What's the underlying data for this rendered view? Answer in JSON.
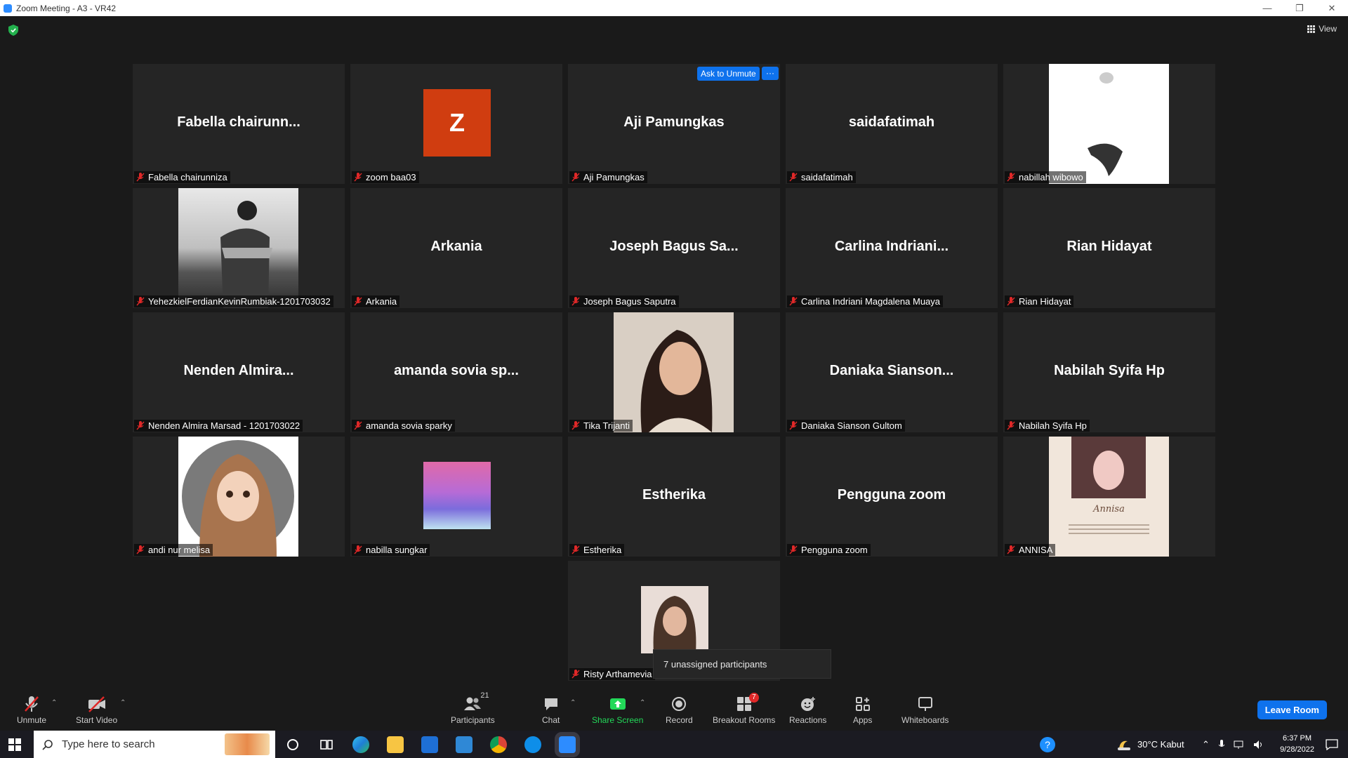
{
  "window": {
    "title": "Zoom Meeting - A3 - VR42"
  },
  "header": {
    "view_label": "View",
    "ask_to_unmute": "Ask to Unmute",
    "more": "···"
  },
  "tiles": [
    {
      "display": "Fabella  chairunn...",
      "label": "Fabella chairunniza"
    },
    {
      "display": "Z",
      "label": "zoom baa03"
    },
    {
      "display": "Aji Pamungkas",
      "label": "Aji Pamungkas"
    },
    {
      "display": "saidafatimah",
      "label": "saidafatimah"
    },
    {
      "display": "",
      "label": "nabillah wibowo"
    },
    {
      "display": "",
      "label": "YehezkielFerdianKevinRumbiak-1201703032"
    },
    {
      "display": "Arkania",
      "label": "Arkania"
    },
    {
      "display": "Joseph Bagus Sa...",
      "label": "Joseph Bagus Saputra"
    },
    {
      "display": "Carlina  Indriani...",
      "label": "Carlina Indriani Magdalena Muaya"
    },
    {
      "display": "Rian Hidayat",
      "label": "Rian Hidayat"
    },
    {
      "display": "Nenden  Almira...",
      "label": "Nenden Almira Marsad - 1201703022"
    },
    {
      "display": "amanda sovia sp...",
      "label": "amanda sovia sparky"
    },
    {
      "display": "",
      "label": "Tika Trijanti"
    },
    {
      "display": "Daniaka  Sianson...",
      "label": "Daniaka Sianson Gultom"
    },
    {
      "display": "Nabilah Syifa Hp",
      "label": "Nabilah Syifa Hp"
    },
    {
      "display": "",
      "label": "andi nur melisa"
    },
    {
      "display": "",
      "label": "nabilla sungkar"
    },
    {
      "display": "Estherika",
      "label": "Estherika"
    },
    {
      "display": "Pengguna zoom",
      "label": "Pengguna zoom"
    },
    {
      "display": "",
      "label": "ANNISA"
    },
    {
      "display": "",
      "label": "Risty Arthamevia"
    }
  ],
  "annisa_card_text": "Annisa",
  "tooltip": "7 unassigned participants",
  "toolbar": {
    "unmute": "Unmute",
    "start_video": "Start Video",
    "participants": "Participants",
    "participants_count": "21",
    "chat": "Chat",
    "share_screen": "Share Screen",
    "record": "Record",
    "breakout_rooms": "Breakout Rooms",
    "breakout_badge": "7",
    "reactions": "Reactions",
    "apps": "Apps",
    "whiteboards": "Whiteboards",
    "leave_room": "Leave Room"
  },
  "taskbar": {
    "search_placeholder": "Type here to search",
    "weather": "30°C  Kabut",
    "time": "6:37 PM",
    "date": "9/28/2022"
  },
  "colors": {
    "accent": "#0e72ed",
    "tile_bg": "#252525",
    "meeting_bg": "#1a1a1a",
    "muted_red": "#e02828",
    "share_green": "#23d959",
    "z_avatar": "#d03d10"
  }
}
